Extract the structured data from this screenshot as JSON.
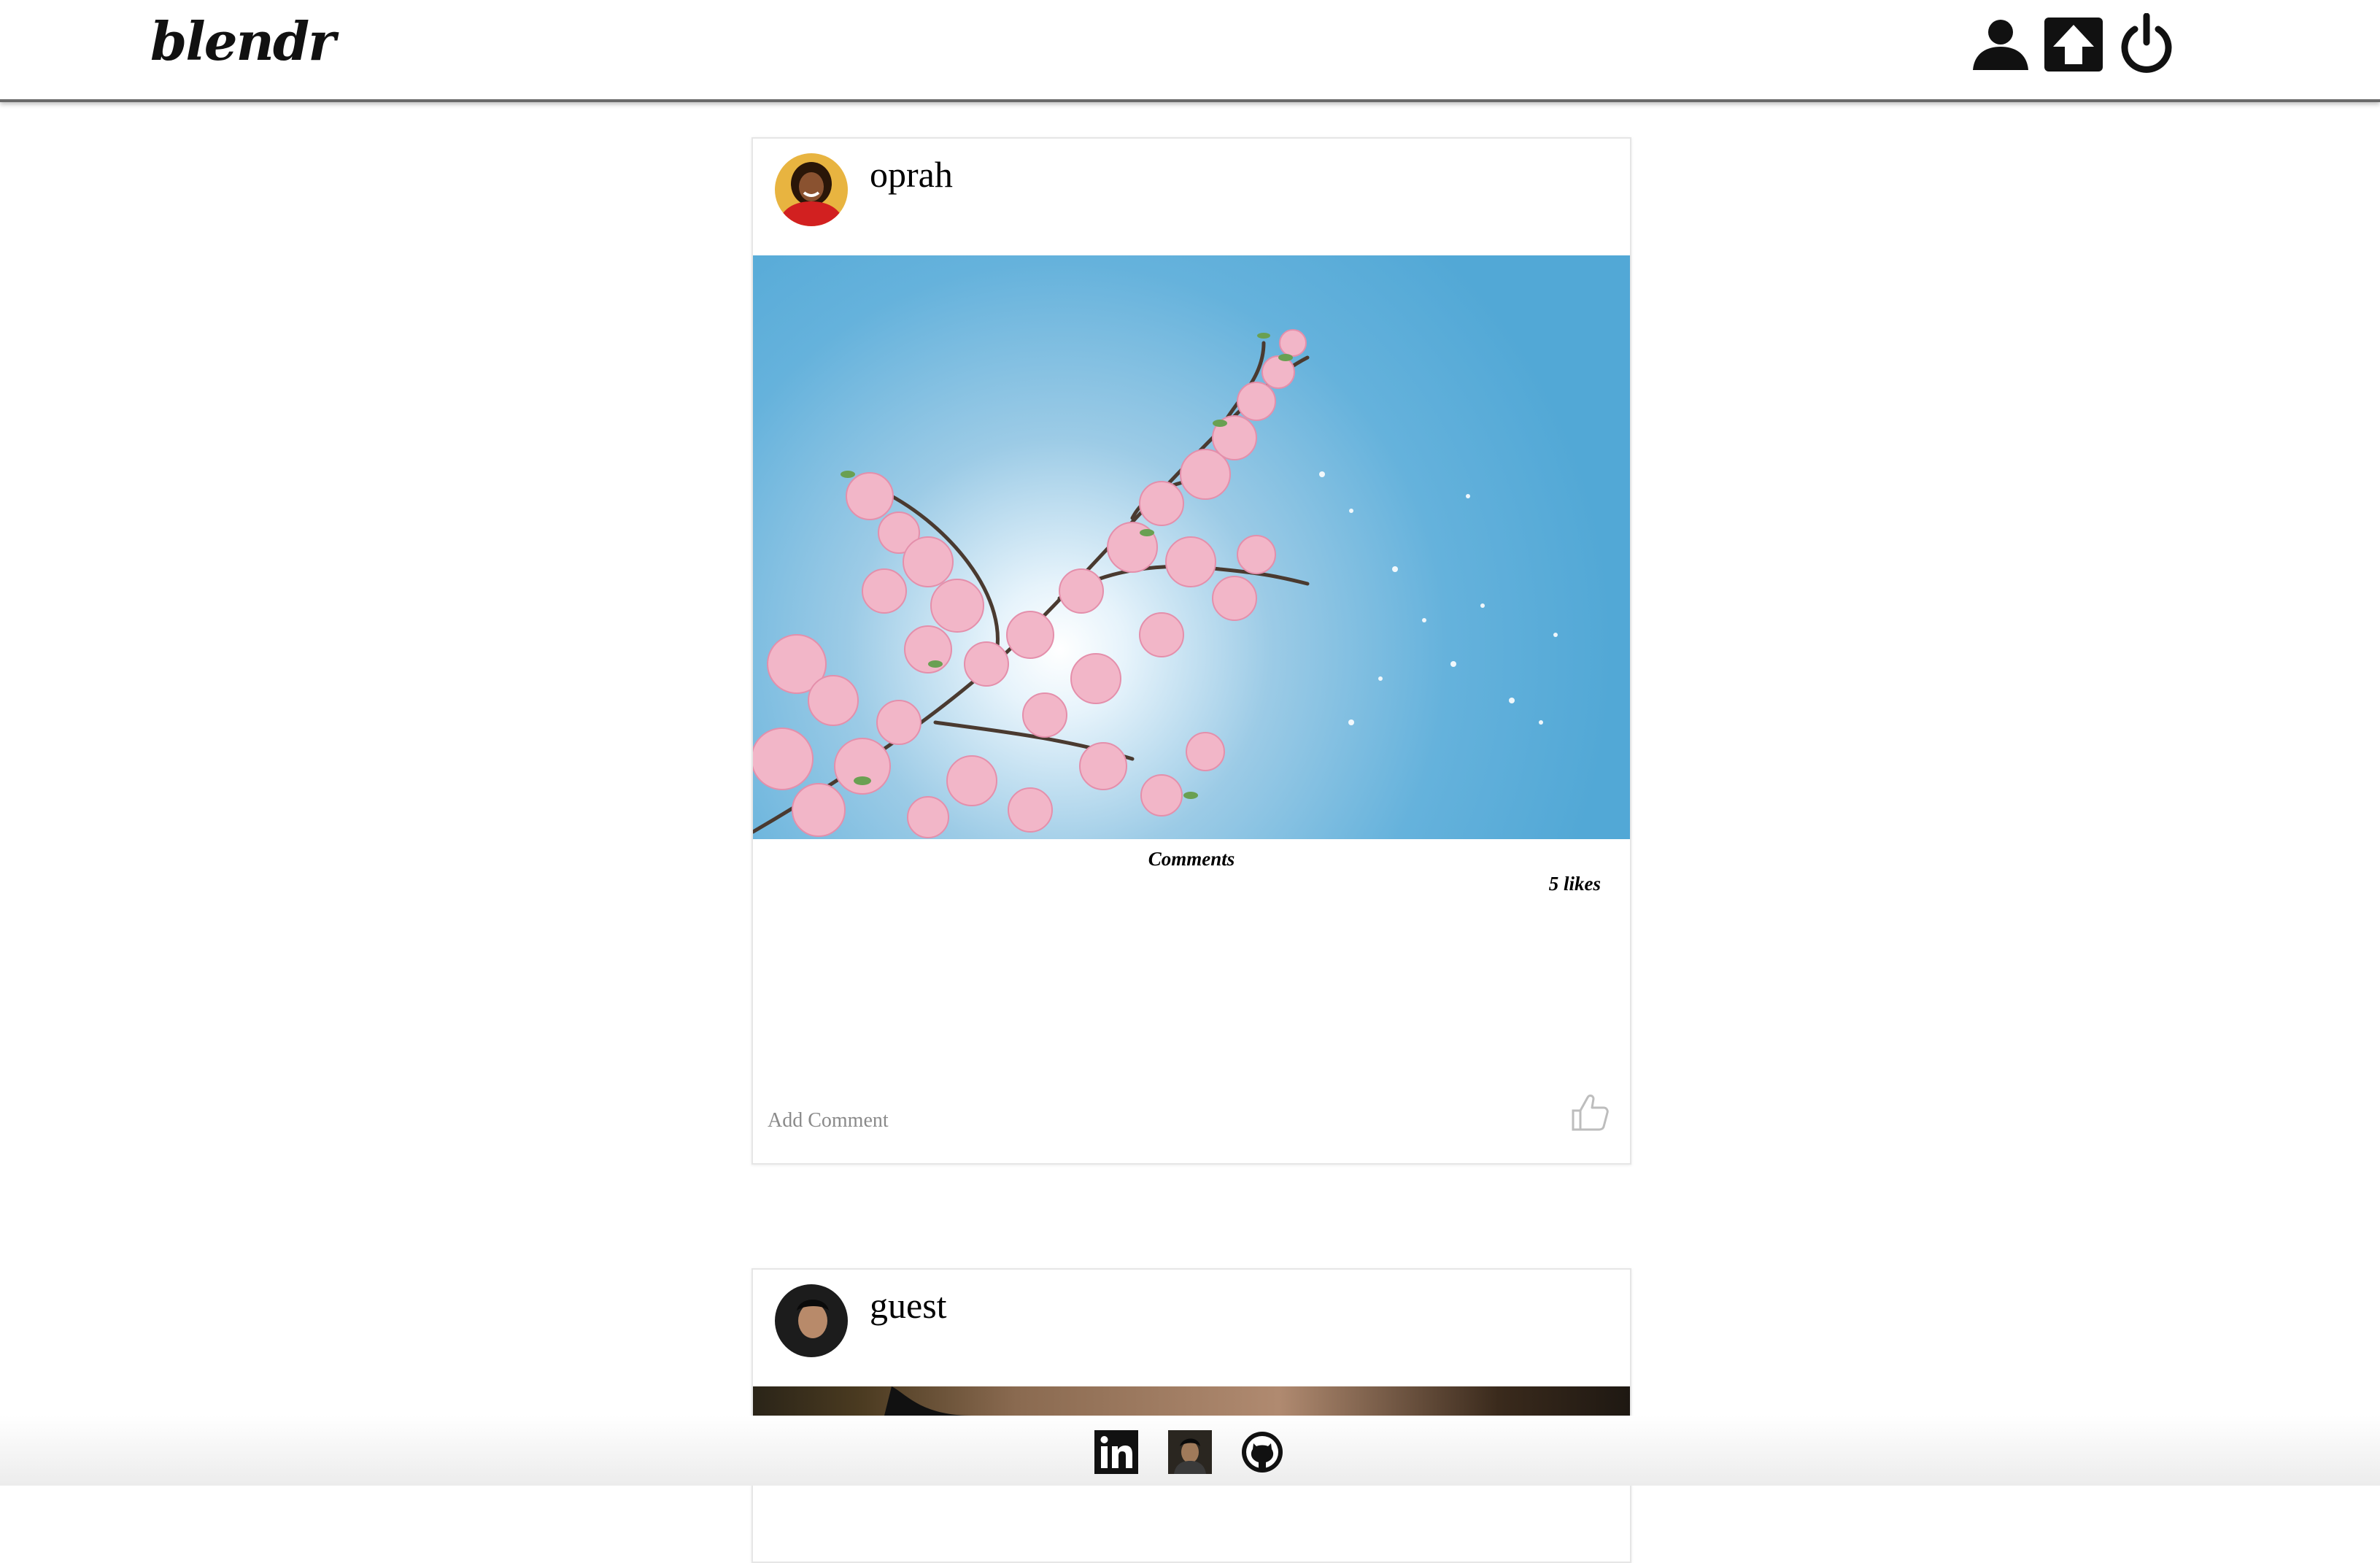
{
  "header": {
    "logo": "blendr",
    "icons": [
      "user-icon",
      "upload-icon",
      "power-icon"
    ]
  },
  "posts": [
    {
      "username": "oprah",
      "avatar": "avatar-oprah",
      "comments_title": "Comments",
      "likes_label": "5 likes",
      "comment_placeholder": "Add Comment"
    },
    {
      "username": "guest",
      "avatar": "avatar-guest"
    }
  ],
  "footer": {
    "icons": [
      "linkedin-icon",
      "portfolio-avatar",
      "github-icon"
    ]
  },
  "colors": {
    "sky": "#5aaee0",
    "blossom": "#f2b6c8",
    "header_border": "#6a6a6a"
  }
}
